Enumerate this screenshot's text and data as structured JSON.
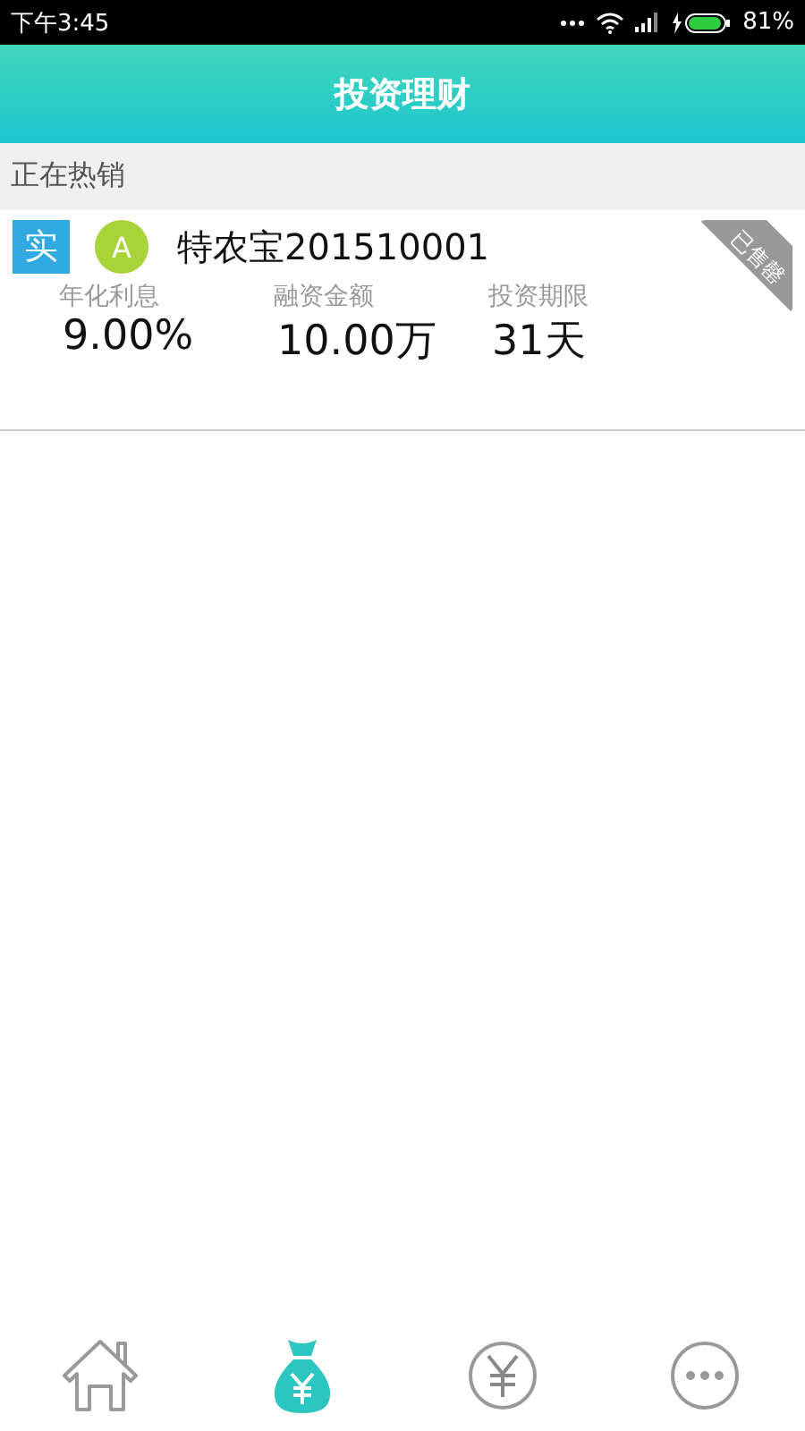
{
  "status_bar": {
    "time": "下午3:45",
    "battery_text": "81%"
  },
  "header": {
    "title": "投资理财"
  },
  "section": {
    "title": "正在热销"
  },
  "products": [
    {
      "type_badge": "实",
      "grade": "A",
      "name": "特农宝201510001",
      "sold_out": true,
      "sold_out_label": "已售罄",
      "stats": [
        {
          "label": "年化利息",
          "value": "9.00%"
        },
        {
          "label": "融资金额",
          "value": "10.00万"
        },
        {
          "label": "投资期限",
          "value": "31天"
        }
      ]
    }
  ],
  "tab_bar": [
    {
      "kind": "home",
      "selected": false
    },
    {
      "kind": "moneybag",
      "selected": true
    },
    {
      "kind": "yen",
      "selected": false
    },
    {
      "kind": "more",
      "selected": false
    }
  ]
}
